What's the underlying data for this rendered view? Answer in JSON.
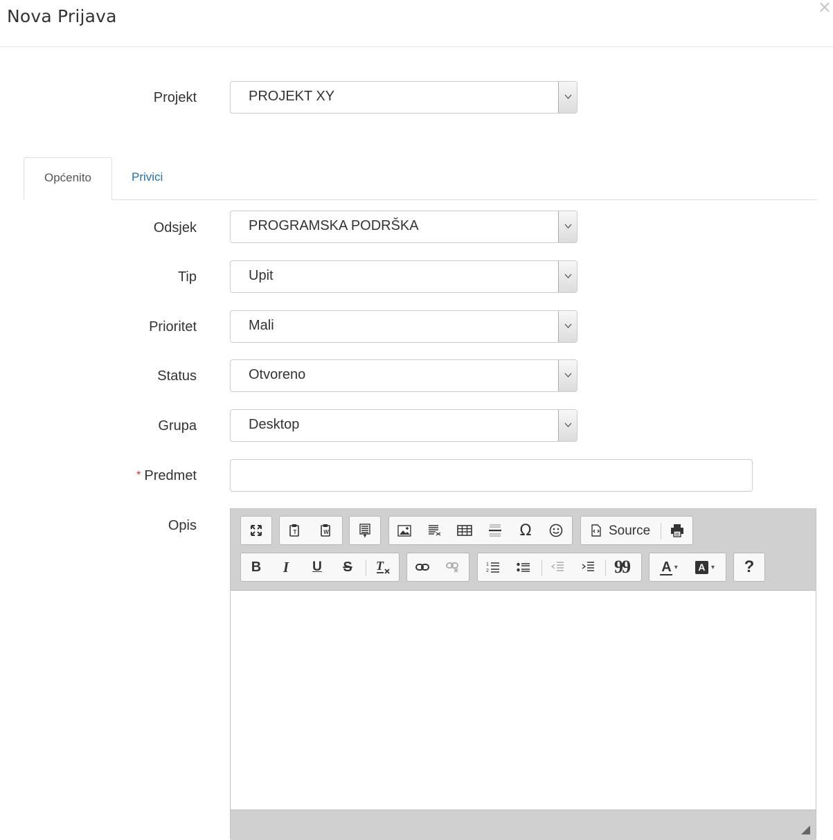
{
  "modal": {
    "title": "Nova Prijava",
    "close": "×"
  },
  "project": {
    "label": "Projekt",
    "value": "PROJEKT XY"
  },
  "tabs": [
    {
      "label": "Općenito",
      "active": true
    },
    {
      "label": "Privici",
      "active": false
    }
  ],
  "fields": {
    "odsjek": {
      "label": "Odsjek",
      "value": "PROGRAMSKA PODRŠKA"
    },
    "tip": {
      "label": "Tip",
      "value": "Upit"
    },
    "prioritet": {
      "label": "Prioritet",
      "value": "Mali"
    },
    "status": {
      "label": "Status",
      "value": "Otvoreno"
    },
    "grupa": {
      "label": "Grupa",
      "value": "Desktop"
    },
    "predmet": {
      "label": "Predmet",
      "required_mark": "*",
      "value": ""
    },
    "opis": {
      "label": "Opis"
    }
  },
  "editor": {
    "source_label": "Source",
    "bold": "B",
    "italic": "I",
    "underline": "U",
    "strike": "S",
    "omega": "Ω",
    "quote": "99",
    "help": "?",
    "text_color": "A",
    "bg_color": "A"
  },
  "colors": {
    "accent_link": "#1f6fb2",
    "required": "#c9302c",
    "toolbar_bg": "#d0d0d0"
  }
}
